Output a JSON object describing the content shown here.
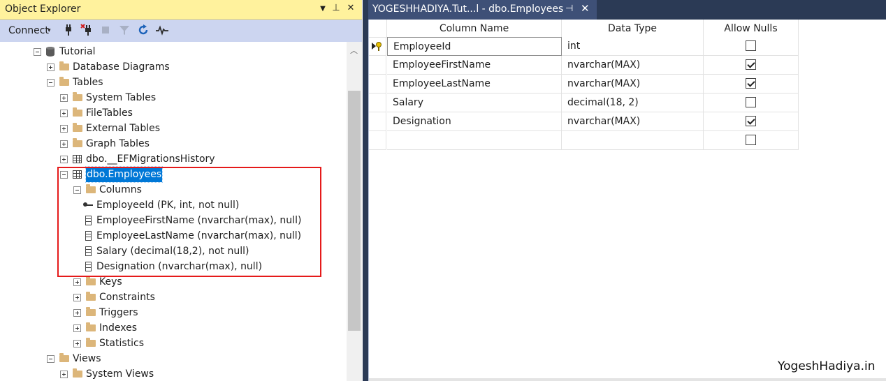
{
  "object_explorer": {
    "title": "Object Explorer",
    "title_buttons": {
      "dropdown": "▼",
      "pin": "⊥",
      "close": "✕"
    },
    "toolbar": {
      "connect_label": "Connect",
      "caret": "▾"
    },
    "tree": [
      {
        "label": "Tutorial",
        "icon": "database-icon",
        "toggle": "minus",
        "level": 0
      },
      {
        "label": "Database Diagrams",
        "icon": "folder-icon",
        "toggle": "plus",
        "level": 1
      },
      {
        "label": "Tables",
        "icon": "folder-icon",
        "toggle": "minus",
        "level": 1
      },
      {
        "label": "System Tables",
        "icon": "folder-icon",
        "toggle": "plus",
        "level": 2
      },
      {
        "label": "FileTables",
        "icon": "folder-icon",
        "toggle": "plus",
        "level": 2
      },
      {
        "label": "External Tables",
        "icon": "folder-icon",
        "toggle": "plus",
        "level": 2
      },
      {
        "label": "Graph Tables",
        "icon": "folder-icon",
        "toggle": "plus",
        "level": 2
      },
      {
        "label": "dbo.__EFMigrationsHistory",
        "icon": "table-icon",
        "toggle": "plus",
        "level": 2
      },
      {
        "label": "dbo.Employees",
        "icon": "table-icon",
        "toggle": "minus",
        "level": 2,
        "selected": true
      },
      {
        "label": "Columns",
        "icon": "folder-icon",
        "toggle": "minus",
        "level": 3
      },
      {
        "label": "EmployeeId (PK, int, not null)",
        "icon": "key-icon",
        "toggle": "none",
        "level": 4
      },
      {
        "label": "EmployeeFirstName (nvarchar(max), null)",
        "icon": "column-icon",
        "toggle": "none",
        "level": 4
      },
      {
        "label": "EmployeeLastName (nvarchar(max), null)",
        "icon": "column-icon",
        "toggle": "none",
        "level": 4
      },
      {
        "label": "Salary (decimal(18,2), not null)",
        "icon": "column-icon",
        "toggle": "none",
        "level": 4
      },
      {
        "label": "Designation (nvarchar(max), null)",
        "icon": "column-icon",
        "toggle": "none",
        "level": 4
      },
      {
        "label": "Keys",
        "icon": "folder-icon",
        "toggle": "plus",
        "level": 3
      },
      {
        "label": "Constraints",
        "icon": "folder-icon",
        "toggle": "plus",
        "level": 3
      },
      {
        "label": "Triggers",
        "icon": "folder-icon",
        "toggle": "plus",
        "level": 3
      },
      {
        "label": "Indexes",
        "icon": "folder-icon",
        "toggle": "plus",
        "level": 3
      },
      {
        "label": "Statistics",
        "icon": "folder-icon",
        "toggle": "plus",
        "level": 3
      },
      {
        "label": "Views",
        "icon": "folder-icon",
        "toggle": "minus",
        "level": 1
      },
      {
        "label": "System Views",
        "icon": "folder-icon",
        "toggle": "plus",
        "level": 2
      }
    ]
  },
  "designer": {
    "tab_title": "YOGESHHADIYA.Tut...l - dbo.Employees",
    "tab_pin": "⊣",
    "tab_close": "✕",
    "headers": {
      "column_name": "Column Name",
      "data_type": "Data Type",
      "allow_nulls": "Allow Nulls"
    },
    "rows": [
      {
        "column_name": "EmployeeId",
        "data_type": "int",
        "allow_nulls": false,
        "primary_key": true
      },
      {
        "column_name": "EmployeeFirstName",
        "data_type": "nvarchar(MAX)",
        "allow_nulls": true
      },
      {
        "column_name": "EmployeeLastName",
        "data_type": "nvarchar(MAX)",
        "allow_nulls": true
      },
      {
        "column_name": "Salary",
        "data_type": "decimal(18, 2)",
        "allow_nulls": false
      },
      {
        "column_name": "Designation",
        "data_type": "nvarchar(MAX)",
        "allow_nulls": true
      },
      {
        "column_name": "",
        "data_type": "",
        "allow_nulls": false
      }
    ]
  },
  "watermark": "YogeshHadiya.in",
  "colors": {
    "title_bar": "#fff29d",
    "toolbar": "#ccd5f0",
    "selection": "#0078d7",
    "highlight_border": "#e51a1a",
    "tab_bg": "#2b3a55"
  }
}
